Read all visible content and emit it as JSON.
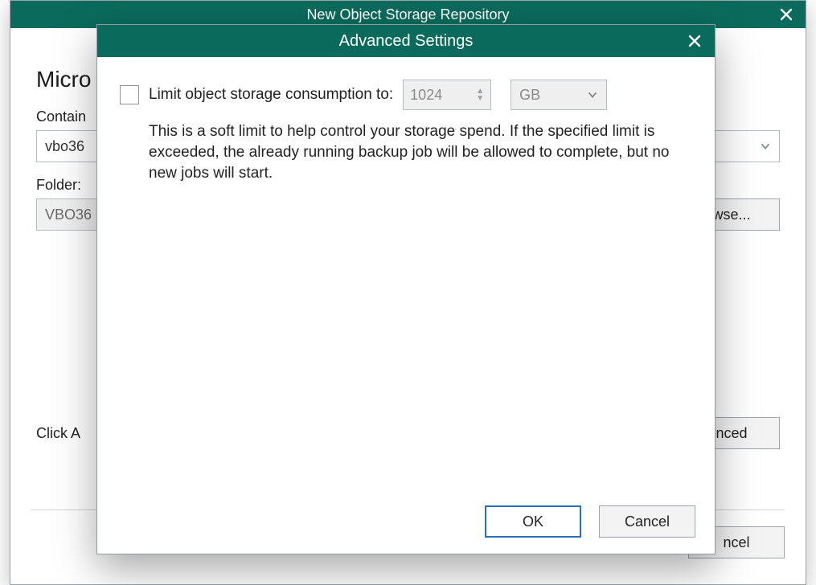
{
  "colors": {
    "brand": "#0a6b5c",
    "accent_blue": "#2a6fbf"
  },
  "back": {
    "title": "New Object Storage Repository",
    "heading_visible": "Micro",
    "container": {
      "label_visible": "Contain",
      "value_visible": "vbo36"
    },
    "folder": {
      "label": "Folder:",
      "value_visible": "VBO36",
      "browse_visible": "wse..."
    },
    "advanced_hint_visible": "Click A",
    "advanced_button_visible": "nced",
    "footer": {
      "cancel_visible": "ncel"
    }
  },
  "front": {
    "title": "Advanced Settings",
    "limit": {
      "checkbox_checked": false,
      "label": "Limit object storage consumption to:",
      "value": "1024",
      "unit": "GB"
    },
    "description": "This is a soft limit to help control your storage spend. If the specified limit is exceeded, the already running backup job will be allowed to complete, but no new jobs will start.",
    "footer": {
      "ok": "OK",
      "cancel": "Cancel"
    }
  }
}
